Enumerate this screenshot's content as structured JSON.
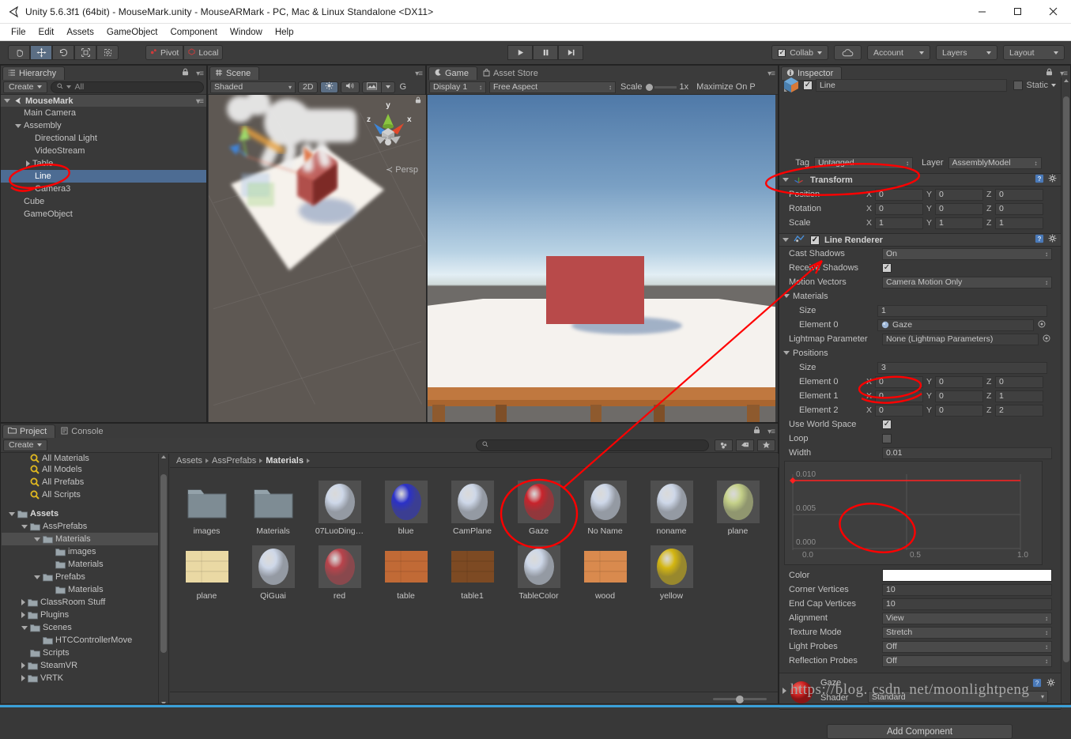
{
  "window": {
    "title": "Unity 5.6.3f1 (64bit) - MouseMark.unity - MouseARMark - PC, Mac & Linux Standalone <DX11>",
    "minimize": "─",
    "maximize": "☐",
    "close": "✕"
  },
  "menubar": {
    "items": [
      "File",
      "Edit",
      "Assets",
      "GameObject",
      "Component",
      "Window",
      "Help"
    ]
  },
  "toolbar": {
    "transform_tools": [
      {
        "name": "hand-tool",
        "glyph": "✋",
        "active": false
      },
      {
        "name": "move-tool",
        "glyph": "✥",
        "active": true
      },
      {
        "name": "rotate-tool",
        "glyph": "↻",
        "active": false
      },
      {
        "name": "scale-tool",
        "glyph": "⤢",
        "active": false
      },
      {
        "name": "rect-tool",
        "glyph": "▣",
        "active": false
      }
    ],
    "pivot_label": "Pivot",
    "local_label": "Local",
    "play_label": "▶",
    "pause_label": "‖",
    "step_label": "▶|",
    "collab_label": "Collab",
    "cloud_label": "☁",
    "account_label": "Account",
    "layers_label": "Layers",
    "layout_label": "Layout"
  },
  "hierarchy": {
    "tab_label": "Hierarchy",
    "create_label": "Create",
    "search_placeholder": "All",
    "scene_name": "MouseMark",
    "items": [
      {
        "label": "Main Camera",
        "depth": 1,
        "toggle": "none",
        "selected": false
      },
      {
        "label": "Assembly",
        "depth": 1,
        "toggle": "open",
        "selected": false
      },
      {
        "label": "Directional Light",
        "depth": 2,
        "toggle": "none",
        "selected": false
      },
      {
        "label": "VideoStream",
        "depth": 2,
        "toggle": "none",
        "selected": false
      },
      {
        "label": "Table",
        "depth": 2,
        "toggle": "closed",
        "selected": false
      },
      {
        "label": "Line",
        "depth": 2,
        "toggle": "none",
        "selected": true
      },
      {
        "label": "Camera3",
        "depth": 2,
        "toggle": "none",
        "selected": false
      },
      {
        "label": "Cube",
        "depth": 1,
        "toggle": "none",
        "selected": false
      },
      {
        "label": "GameObject",
        "depth": 1,
        "toggle": "none",
        "selected": false
      }
    ]
  },
  "scene": {
    "tab_label": "Scene",
    "shading_mode": "Shaded",
    "mode_2d": "2D",
    "gizmo_label": "Persp",
    "axis_x": "x",
    "axis_y": "y",
    "axis_z": "z",
    "extra_label": "G"
  },
  "game": {
    "tab_label": "Game",
    "asset_store_tab": "Asset Store",
    "display_label": "Display 1",
    "aspect_label": "Free Aspect",
    "scale_label": "Scale",
    "scale_value": "1x",
    "maximize_label": "Maximize On P"
  },
  "inspector": {
    "tab_label": "Inspector",
    "object_name": "Line",
    "static_label": "Static",
    "tag_label": "Tag",
    "tag_value": "Untagged",
    "layer_label": "Layer",
    "layer_value": "AssemblyModel",
    "transform": {
      "title": "Transform",
      "rows": [
        {
          "label": "Position",
          "x": "0",
          "y": "0",
          "z": "0"
        },
        {
          "label": "Rotation",
          "x": "0",
          "y": "0",
          "z": "0"
        },
        {
          "label": "Scale",
          "x": "1",
          "y": "1",
          "z": "1"
        }
      ]
    },
    "line_renderer": {
      "title": "Line Renderer",
      "enabled": true,
      "cast_shadows_label": "Cast Shadows",
      "cast_shadows_value": "On",
      "receive_shadows_label": "Receive Shadows",
      "receive_shadows_value": true,
      "motion_vectors_label": "Motion Vectors",
      "motion_vectors_value": "Camera Motion Only",
      "materials_label": "Materials",
      "materials_size_label": "Size",
      "materials_size_value": "1",
      "materials_element0_label": "Element 0",
      "materials_element0_value": "Gaze",
      "lightmap_label": "Lightmap Parameter",
      "lightmap_value": "None (Lightmap Parameters)",
      "positions_label": "Positions",
      "positions_size_label": "Size",
      "positions_size_value": "3",
      "positions": [
        {
          "label": "Element 0",
          "x": "0",
          "y": "0",
          "z": "0"
        },
        {
          "label": "Element 1",
          "x": "0",
          "y": "0",
          "z": "1"
        },
        {
          "label": "Element 2",
          "x": "0",
          "y": "0",
          "z": "2"
        }
      ],
      "use_world_space_label": "Use World Space",
      "use_world_space_value": true,
      "loop_label": "Loop",
      "loop_value": false,
      "width_label": "Width",
      "width_value": "0.01",
      "curve": {
        "y_ticks": [
          "0.010",
          "0.005",
          "0.000"
        ],
        "x_ticks": [
          "0.0",
          "0.5",
          "1.0"
        ],
        "curve_color": "#ff2020"
      },
      "color_label": "Color",
      "color_value": "#ffffff",
      "corner_vertices_label": "Corner Vertices",
      "corner_vertices_value": "10",
      "end_cap_vertices_label": "End Cap Vertices",
      "end_cap_vertices_value": "10",
      "alignment_label": "Alignment",
      "alignment_value": "View",
      "texture_mode_label": "Texture Mode",
      "texture_mode_value": "Stretch",
      "light_probes_label": "Light Probes",
      "light_probes_value": "Off",
      "reflection_probes_label": "Reflection Probes",
      "reflection_probes_value": "Off"
    },
    "material": {
      "name": "Gaze",
      "shader_label": "Shader",
      "shader_value": "Standard",
      "swatch_color": "#cc2222"
    },
    "add_component_label": "Add Component"
  },
  "project": {
    "tab_label": "Project",
    "console_tab_label": "Console",
    "create_label": "Create",
    "search_placeholder": "",
    "tree": [
      {
        "label": "All Materials",
        "depth": 1,
        "icon": "search",
        "toggle": "none",
        "selected": false,
        "clipped": true
      },
      {
        "label": "All Models",
        "depth": 1,
        "icon": "search",
        "toggle": "none",
        "selected": false
      },
      {
        "label": "All Prefabs",
        "depth": 1,
        "icon": "search",
        "toggle": "none",
        "selected": false
      },
      {
        "label": "All Scripts",
        "depth": 1,
        "icon": "search",
        "toggle": "none",
        "selected": false
      },
      {
        "label": "",
        "depth": 0,
        "icon": "none",
        "toggle": "none",
        "selected": false
      },
      {
        "label": "Assets",
        "depth": 0,
        "icon": "folder",
        "toggle": "open",
        "selected": false,
        "bold": true
      },
      {
        "label": "AssPrefabs",
        "depth": 1,
        "icon": "folder",
        "toggle": "open",
        "selected": false
      },
      {
        "label": "Materials",
        "depth": 2,
        "icon": "folder",
        "toggle": "open",
        "selected": true
      },
      {
        "label": "images",
        "depth": 3,
        "icon": "folder",
        "toggle": "none",
        "selected": false
      },
      {
        "label": "Materials",
        "depth": 3,
        "icon": "folder",
        "toggle": "none",
        "selected": false
      },
      {
        "label": "Prefabs",
        "depth": 2,
        "icon": "folder",
        "toggle": "open",
        "selected": false
      },
      {
        "label": "Materials",
        "depth": 3,
        "icon": "folder",
        "toggle": "none",
        "selected": false
      },
      {
        "label": "ClassRoom Stuff",
        "depth": 1,
        "icon": "folder",
        "toggle": "closed",
        "selected": false
      },
      {
        "label": "Plugins",
        "depth": 1,
        "icon": "folder",
        "toggle": "closed",
        "selected": false
      },
      {
        "label": "Scenes",
        "depth": 1,
        "icon": "folder",
        "toggle": "open",
        "selected": false
      },
      {
        "label": "HTCControllerMove",
        "depth": 2,
        "icon": "folder",
        "toggle": "none",
        "selected": false
      },
      {
        "label": "Scripts",
        "depth": 1,
        "icon": "folder",
        "toggle": "none",
        "selected": false
      },
      {
        "label": "SteamVR",
        "depth": 1,
        "icon": "folder",
        "toggle": "closed",
        "selected": false
      },
      {
        "label": "VRTK",
        "depth": 1,
        "icon": "folder",
        "toggle": "closed",
        "selected": false
      }
    ],
    "breadcrumb": [
      "Assets",
      "AssPrefabs",
      "Materials"
    ],
    "assets": [
      {
        "name": "images",
        "kind": "folder",
        "color": "#6e7e85"
      },
      {
        "name": "Materials",
        "kind": "folder",
        "color": "#6e7e85"
      },
      {
        "name": "07LuoDing…",
        "kind": "sphere",
        "color": "#cdd7e8"
      },
      {
        "name": "blue",
        "kind": "sphere",
        "color": "#2b31c8"
      },
      {
        "name": "CamPlane",
        "kind": "sphere",
        "color": "#cdd7e8"
      },
      {
        "name": "Gaze",
        "kind": "sphere",
        "color": "#c8242c"
      },
      {
        "name": "No Name",
        "kind": "sphere",
        "color": "#cdd7e8"
      },
      {
        "name": "noname",
        "kind": "sphere",
        "color": "#cdd7e8"
      },
      {
        "name": "plane",
        "kind": "sphere",
        "color": "#c5d189"
      },
      {
        "name": "plane",
        "kind": "texture",
        "color": "#ead9a4"
      },
      {
        "name": "QiGuai",
        "kind": "sphere",
        "color": "#cdd7e8"
      },
      {
        "name": "red",
        "kind": "sphere",
        "color": "#b8434b"
      },
      {
        "name": "table",
        "kind": "texture",
        "color": "#c16a36"
      },
      {
        "name": "table1",
        "kind": "texture",
        "color": "#7d4a23"
      },
      {
        "name": "TableColor",
        "kind": "sphere",
        "color": "#cdd7e8"
      },
      {
        "name": "wood",
        "kind": "texture",
        "color": "#d98a4e"
      },
      {
        "name": "yellow",
        "kind": "sphere",
        "color": "#d4b611"
      }
    ]
  },
  "watermark": "https://blog. csdn. net/moonlightpeng",
  "annotations": {
    "color": "#ff0000"
  }
}
